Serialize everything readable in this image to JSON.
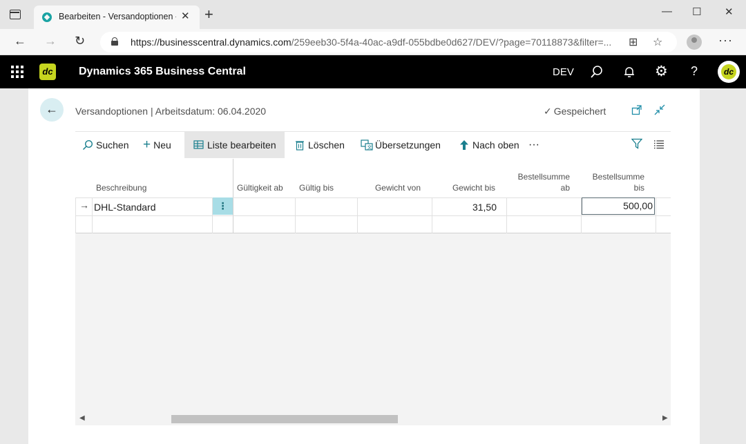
{
  "browser": {
    "tab_title": "Bearbeiten - Versandoptionen - D",
    "tab_close": "✕",
    "new_tab": "+",
    "url_host": "https://businesscentral.dynamics.com",
    "url_rest": "/259eeb30-5f4a-40ac-a9df-055bdbe0d627/DEV/?page=70118873&filter=...",
    "minimize": "—",
    "maximize": "☐",
    "close": "✕",
    "back": "←",
    "forward": "→",
    "refresh": "↻",
    "more": "···"
  },
  "header": {
    "logo_text": "dc",
    "app_title": "Dynamics 365 Business Central",
    "environment": "DEV",
    "avatar_text": "dc"
  },
  "page": {
    "back": "←",
    "breadcrumb": "Versandoptionen | Arbeitsdatum: 06.04.2020",
    "saved": "Gespeichert",
    "saved_check": "✓"
  },
  "actions": {
    "search": "Suchen",
    "new": "Neu",
    "edit_list": "Liste bearbeiten",
    "delete": "Löschen",
    "translations": "Übersetzungen",
    "move_up": "Nach oben",
    "more": "···"
  },
  "grid": {
    "columns": {
      "beschreibung": "Beschreibung",
      "gueltigkeit_ab": "Gültigkeit ab",
      "gueltig_bis": "Gültig bis",
      "gewicht_von": "Gewicht von",
      "gewicht_bis": "Gewicht bis",
      "bestellsumme_ab_1": "Bestellsumme",
      "bestellsumme_ab_2": "ab",
      "bestellsumme_bis_1": "Bestellsumme",
      "bestellsumme_bis_2": "bis"
    },
    "row1": {
      "arrow": "→",
      "beschreibung": "DHL-Standard",
      "menu": "⋮",
      "gewicht_bis": "31,50",
      "bestellsumme_bis": "500,00"
    }
  },
  "icons": [
    "sidebar-icon",
    "lock-icon",
    "split-screen-icon",
    "favorites-icon",
    "search-icon",
    "bell-icon",
    "gear-icon",
    "help-icon",
    "filter-icon",
    "list-icon",
    "pop-out-icon",
    "collapse-icon"
  ]
}
